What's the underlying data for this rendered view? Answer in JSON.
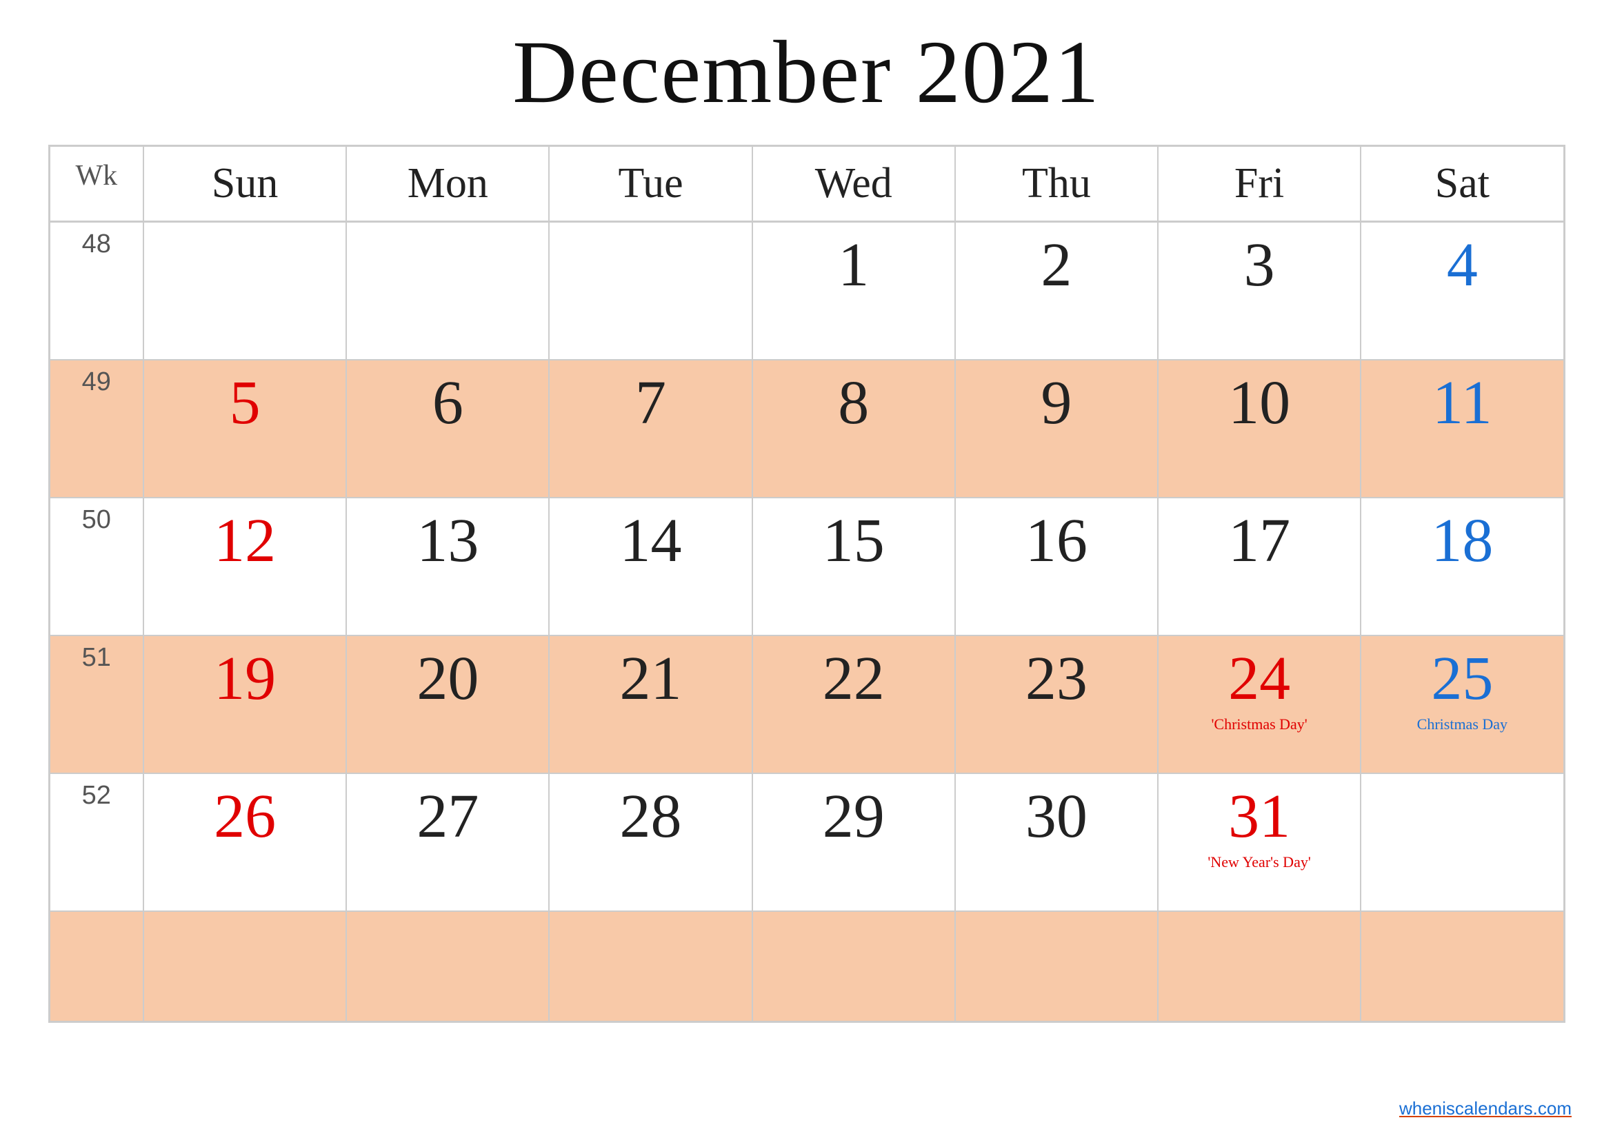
{
  "title": "December 2021",
  "header": {
    "wk": "Wk",
    "days": [
      "Sun",
      "Mon",
      "Tue",
      "Wed",
      "Thu",
      "Fri",
      "Sat"
    ]
  },
  "weeks": [
    {
      "wk": "48",
      "rowClass": "week-row-even",
      "days": [
        {
          "num": "",
          "color": "empty"
        },
        {
          "num": "",
          "color": "empty"
        },
        {
          "num": "",
          "color": "empty"
        },
        {
          "num": "1",
          "color": "dark"
        },
        {
          "num": "2",
          "color": "dark"
        },
        {
          "num": "3",
          "color": "dark"
        },
        {
          "num": "4",
          "color": "blue"
        }
      ]
    },
    {
      "wk": "49",
      "rowClass": "week-row-odd",
      "days": [
        {
          "num": "5",
          "color": "red"
        },
        {
          "num": "6",
          "color": "dark"
        },
        {
          "num": "7",
          "color": "dark"
        },
        {
          "num": "8",
          "color": "dark"
        },
        {
          "num": "9",
          "color": "dark"
        },
        {
          "num": "10",
          "color": "dark"
        },
        {
          "num": "11",
          "color": "blue"
        }
      ]
    },
    {
      "wk": "50",
      "rowClass": "week-row-even",
      "days": [
        {
          "num": "12",
          "color": "red"
        },
        {
          "num": "13",
          "color": "dark"
        },
        {
          "num": "14",
          "color": "dark"
        },
        {
          "num": "15",
          "color": "dark"
        },
        {
          "num": "16",
          "color": "dark"
        },
        {
          "num": "17",
          "color": "dark"
        },
        {
          "num": "18",
          "color": "blue"
        }
      ]
    },
    {
      "wk": "51",
      "rowClass": "week-row-odd",
      "days": [
        {
          "num": "19",
          "color": "red"
        },
        {
          "num": "20",
          "color": "dark"
        },
        {
          "num": "21",
          "color": "dark"
        },
        {
          "num": "22",
          "color": "dark"
        },
        {
          "num": "23",
          "color": "dark"
        },
        {
          "num": "24",
          "color": "red",
          "holiday": "'Christmas Day'"
        },
        {
          "num": "25",
          "color": "blue",
          "holiday": "Christmas Day"
        }
      ]
    },
    {
      "wk": "52",
      "rowClass": "week-row-even",
      "days": [
        {
          "num": "26",
          "color": "red"
        },
        {
          "num": "27",
          "color": "dark"
        },
        {
          "num": "28",
          "color": "dark"
        },
        {
          "num": "29",
          "color": "dark"
        },
        {
          "num": "30",
          "color": "dark"
        },
        {
          "num": "31",
          "color": "red",
          "holiday": "'New Year's Day'"
        },
        {
          "num": "",
          "color": "empty"
        }
      ]
    }
  ],
  "watermark": {
    "text": "wheniscalendars",
    "suffix": ".com",
    "url": "#"
  }
}
